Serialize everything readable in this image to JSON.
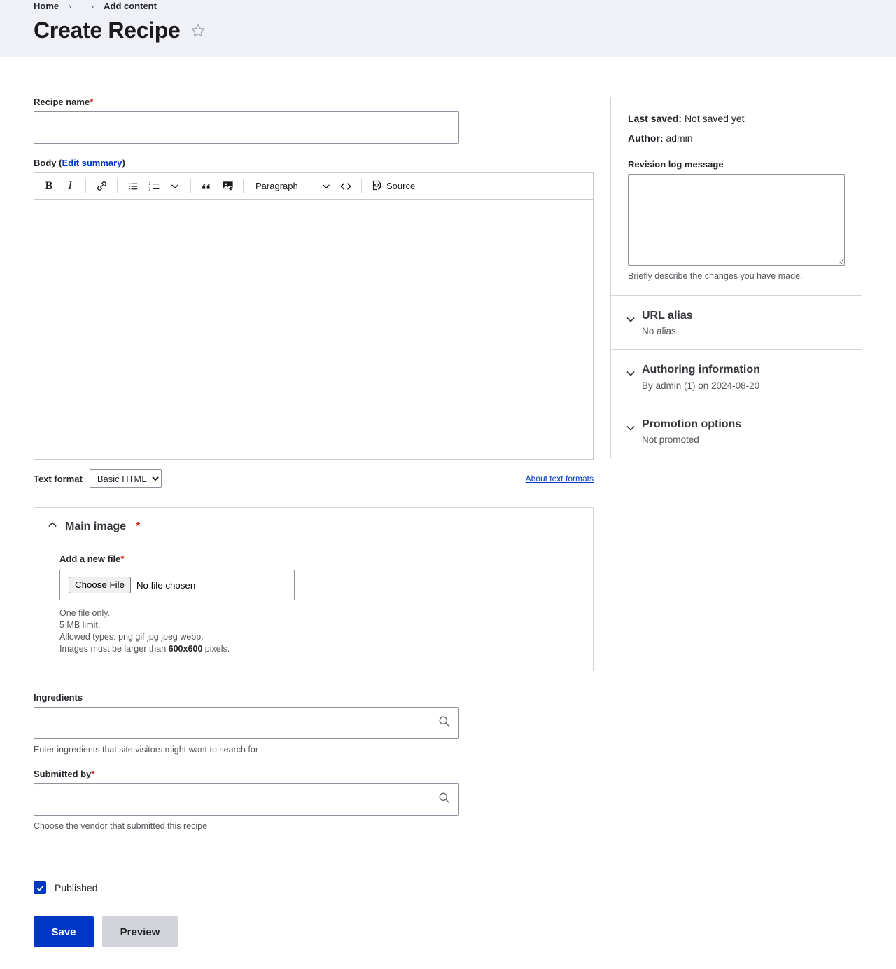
{
  "header": {
    "breadcrumb": [
      {
        "label": "Home",
        "separator": "›"
      },
      {
        "label": "",
        "separator": "›"
      },
      {
        "label": "Add content",
        "separator": ""
      }
    ],
    "title": "Create Recipe",
    "star_icon": "star-outline-icon"
  },
  "form": {
    "recipe_name": {
      "label": "Recipe name",
      "required_mark": "*",
      "value": "",
      "placeholder": ""
    },
    "body": {
      "label": "Body",
      "open_paren": "(",
      "edit_summary_link": "Edit summary",
      "close_paren": ")",
      "value": "",
      "toolbar": {
        "bold": "B",
        "italic": "I",
        "link": "link-icon",
        "bulleted_list": "bulleted-list-icon",
        "numbered_list": "numbered-list-icon",
        "list_dropdown": "chevron-down-icon",
        "block_quote": "block-quote-icon",
        "insert_image": "insert-image-icon",
        "paragraph_style": "Paragraph",
        "paragraph_dropdown": "chevron-down-icon",
        "code": "<>",
        "source_label": "Source",
        "source_icon": "source-editing-icon"
      }
    },
    "text_format": {
      "label": "Text format",
      "selected": "Basic HTML",
      "options": [
        "Basic HTML"
      ],
      "about_link": "About text formats"
    },
    "main_image": {
      "legend": "Main image",
      "required_mark": "*",
      "expanded": true,
      "toggle_icon": "chevron-up-icon",
      "file_label": "Add a new file",
      "file_required_mark": "*",
      "choose_button": "Choose File",
      "file_status": "No file chosen",
      "description_lines": [
        "One file only.",
        "5 MB limit.",
        "Allowed types: png gif jpg jpeg webp."
      ],
      "dimension_prefix": "Images must be larger than ",
      "dimension_value": "600x600",
      "dimension_suffix": " pixels."
    },
    "ingredients": {
      "label": "Ingredients",
      "value": "",
      "placeholder": "",
      "icon": "search-icon",
      "description": "Enter ingredients that site visitors might want to search for"
    },
    "submitted_by": {
      "label": "Submitted by",
      "required_mark": "*",
      "value": "",
      "placeholder": "",
      "icon": "search-icon",
      "description": "Choose the vendor that submitted this recipe"
    },
    "published": {
      "label": "Published",
      "checked": true
    },
    "actions": {
      "save": "Save",
      "preview": "Preview"
    }
  },
  "sidebar": {
    "last_saved_label": "Last saved:",
    "last_saved_value": "Not saved yet",
    "author_label": "Author:",
    "author_value": "admin",
    "revision_log": {
      "label": "Revision log message",
      "value": "",
      "placeholder": "",
      "description": "Briefly describe the changes you have made."
    },
    "sections": [
      {
        "title": "URL alias",
        "summary": "No alias",
        "icon": "chevron-down-icon"
      },
      {
        "title": "Authoring information",
        "summary": "By admin (1) on 2024-08-20",
        "icon": "chevron-down-icon"
      },
      {
        "title": "Promotion options",
        "summary": "Not promoted",
        "icon": "chevron-down-icon"
      }
    ]
  },
  "colors": {
    "header_bg": "#f0f1f6",
    "primary": "#0036c4",
    "secondary": "#d3d4d9",
    "link": "#0035ca",
    "required": "#d72222",
    "border": "#d4d4d8"
  }
}
